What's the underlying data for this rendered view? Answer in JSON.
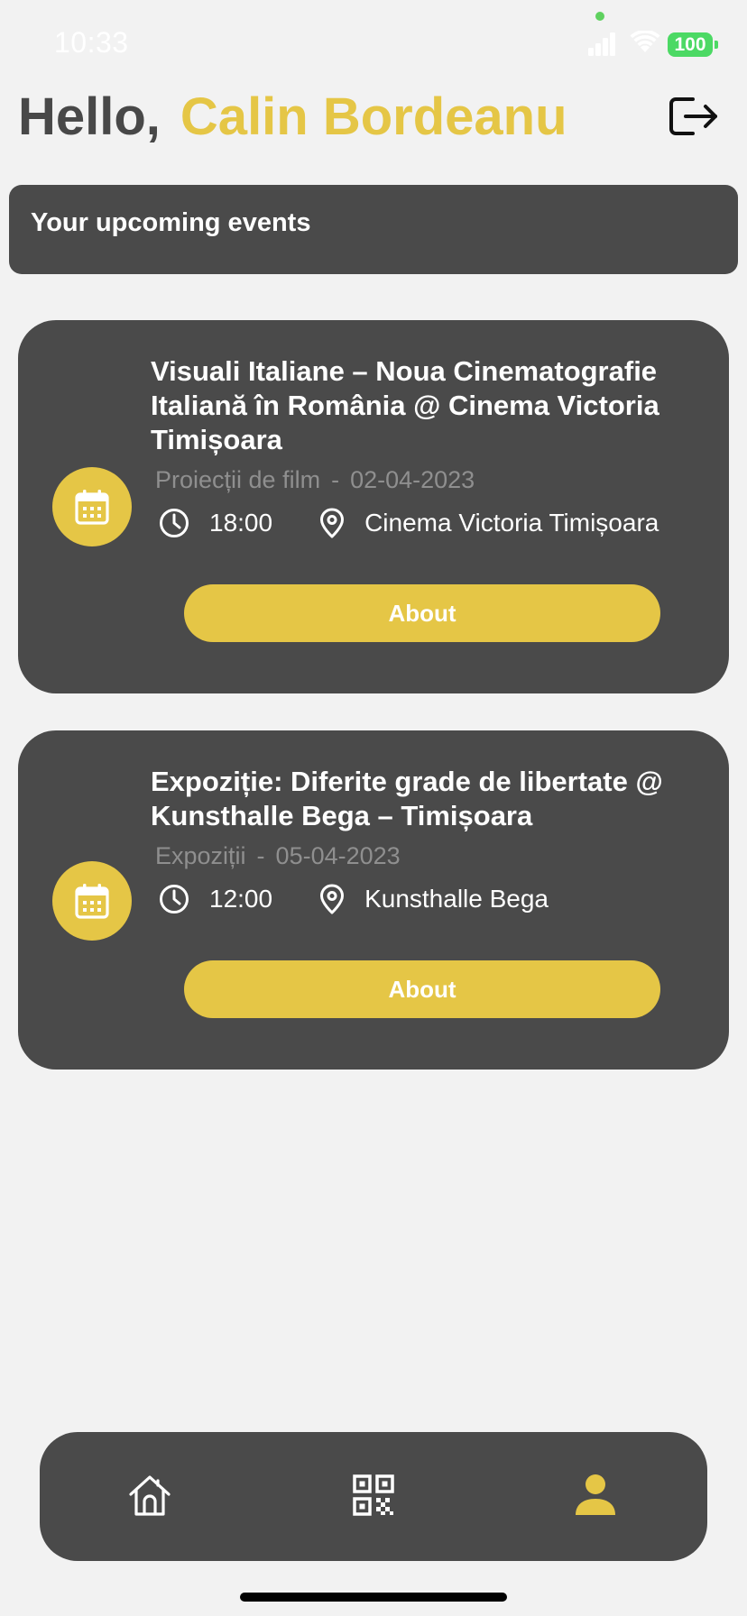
{
  "status_bar": {
    "time": "10:33",
    "battery": "100",
    "battery_color": "#4cd964"
  },
  "header": {
    "greeting": "Hello,",
    "user_name": "Calin Bordeanu"
  },
  "banner": {
    "title": "Your upcoming events"
  },
  "events": [
    {
      "title": "Visuali Italiane – Noua Cinematografie Italiană în România @ Cinema Victoria Timișoara",
      "category": "Proiecții de film",
      "separator": "-",
      "date": "02-04-2023",
      "time": "18:00",
      "location": "Cinema Victoria Timișoara",
      "button_label": "About"
    },
    {
      "title": "Expoziție: Diferite grade de libertate @ Kunsthalle Bega – Timișoara",
      "category": "Expoziții",
      "separator": "-",
      "date": "05-04-2023",
      "time": "12:00",
      "location": "Kunsthalle Bega",
      "button_label": "About"
    }
  ],
  "tab_bar": {
    "items": [
      {
        "name": "home",
        "icon": "home-icon",
        "active": false
      },
      {
        "name": "qr",
        "icon": "qr-code-icon",
        "active": false
      },
      {
        "name": "profile",
        "icon": "person-icon",
        "active": true
      }
    ]
  },
  "colors": {
    "accent": "#e5c646",
    "card_bg": "#4a4a4a",
    "page_bg": "#f2f2f2",
    "muted_text": "#8f8f8f"
  }
}
